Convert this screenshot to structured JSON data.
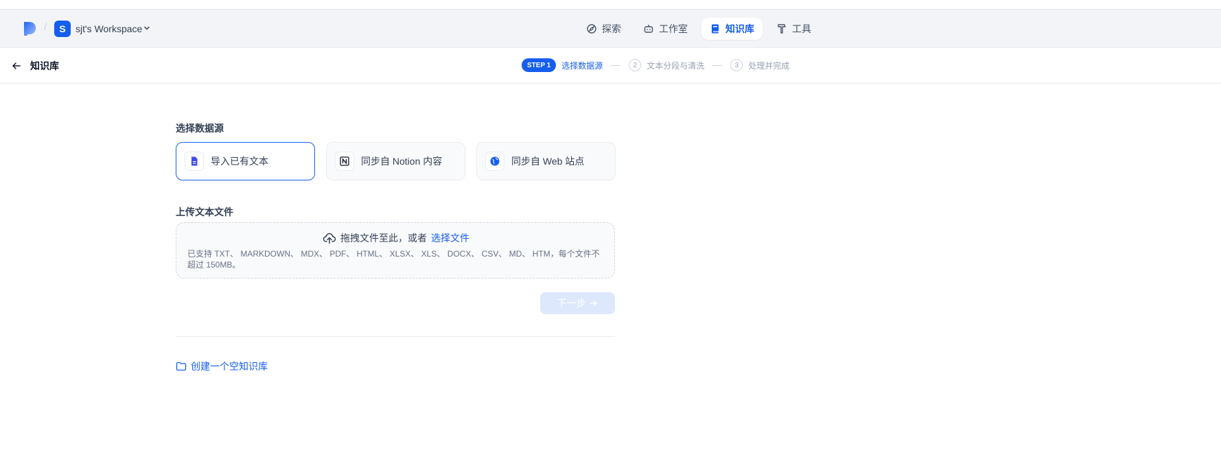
{
  "header": {
    "workspace_initial": "S",
    "workspace_name": "sjt's Workspace",
    "nav": [
      {
        "label": "探索",
        "icon": "explore-icon"
      },
      {
        "label": "工作室",
        "icon": "robot-icon"
      },
      {
        "label": "知识库",
        "icon": "book-icon",
        "active": true
      },
      {
        "label": "工具",
        "icon": "hammer-icon"
      }
    ]
  },
  "subheader": {
    "back_label": "知识库",
    "steps": {
      "active_badge": "STEP 1",
      "active_label": "选择数据源",
      "step2_num": "2",
      "step2_label": "文本分段与清洗",
      "step3_num": "3",
      "step3_label": "处理并完成"
    }
  },
  "main": {
    "source_title": "选择数据源",
    "sources": [
      {
        "label": "导入已有文本",
        "icon": "file-icon",
        "selected": true
      },
      {
        "label": "同步自 Notion 内容",
        "icon": "notion-icon"
      },
      {
        "label": "同步自 Web 站点",
        "icon": "web-icon"
      }
    ],
    "upload_title": "上传文本文件",
    "upload_prompt": "拖拽文件至此，或者",
    "upload_link": "选择文件",
    "upload_hint": "已支持 TXT、 MARKDOWN、 MDX、 PDF、 HTML、 XLSX、 XLS、 DOCX、 CSV、 MD、 HTM，每个文件不超过 150MB。",
    "next_label": "下一步",
    "create_empty_label": "创建一个空知识库"
  },
  "colors": {
    "accent": "#155eef",
    "header_bg": "#f2f4f7",
    "disabled_button": "#dde8fd"
  }
}
